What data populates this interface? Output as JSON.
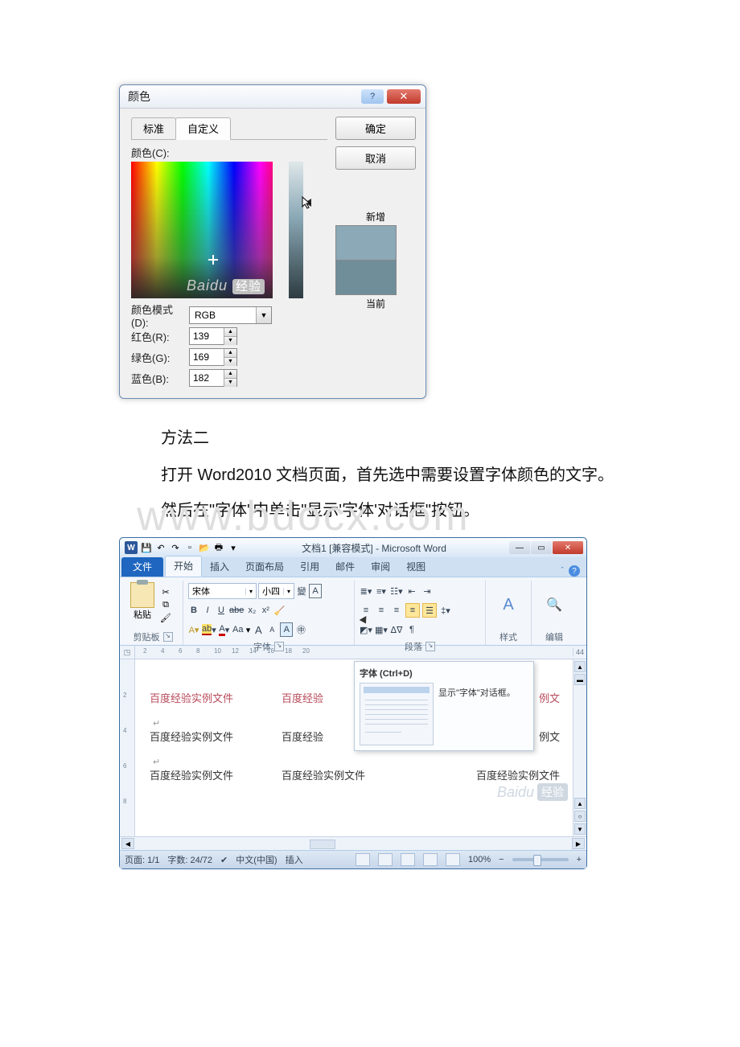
{
  "color_dialog": {
    "title": "颜色",
    "tabs": {
      "standard": "标准",
      "custom": "自定义"
    },
    "buttons": {
      "ok": "确定",
      "cancel": "取消"
    },
    "labels": {
      "colors": "颜色(C):",
      "mode": "颜色模式(D):",
      "red": "红色(R):",
      "green": "绿色(G):",
      "blue": "蓝色(B):",
      "new": "新增",
      "current": "当前"
    },
    "mode_value": "RGB",
    "rgb": {
      "r": "139",
      "g": "169",
      "b": "182"
    },
    "help_glyph": "?",
    "close_glyph": "✕",
    "watermark": {
      "brand": "Baidu",
      "tag": "经验"
    }
  },
  "article": {
    "method_title": "方法二",
    "p1": "打开 Word2010 文档页面，首先选中需要设置字体颜色的文字。",
    "p2": "然后在\"字体\"中单击\"显示'字体'对话框\"按钮。",
    "big_watermark": "www.bdocx.com"
  },
  "word": {
    "title": "文档1 [兼容模式] - Microsoft Word",
    "qat": {
      "save": "💾",
      "undo": "↶",
      "redo": "↷",
      "new": "▫",
      "open": "📂",
      "print": "🖶",
      "more": "▾"
    },
    "window_buttons": {
      "min": "—",
      "max": "▭",
      "close": "✕"
    },
    "tabs": {
      "file": "文件",
      "home": "开始",
      "insert": "插入",
      "layout": "页面布局",
      "references": "引用",
      "mailings": "邮件",
      "review": "审阅",
      "view": "视图"
    },
    "ribbon_right": {
      "minimize": "ˆ",
      "help": "?"
    },
    "groups": {
      "clipboard": {
        "title": "剪贴板",
        "paste": "粘贴"
      },
      "font": {
        "title": "字体",
        "name": "宋体",
        "size": "小四",
        "grow": "A",
        "shrink": "A",
        "case": "Aa",
        "bold": "B",
        "italic": "I",
        "underline": "U",
        "strike": "abe",
        "sub": "x₂",
        "sup": "x²",
        "effects": "A",
        "highlight": "ab",
        "fontcolor": "A",
        "phonetic": "拼",
        "charborder": "A",
        "circled": "㊩",
        "clearfmt": "⌫"
      },
      "paragraph": {
        "title": "段落"
      },
      "styles": {
        "title": "样式",
        "letter": "A"
      },
      "editing": {
        "title": "编辑",
        "icon": "🔍"
      }
    },
    "tooltip": {
      "title": "字体 (Ctrl+D)",
      "desc": "显示\"字体\"对话框。"
    },
    "ruler_numbers": [
      "2",
      "4",
      "6",
      "8",
      "10",
      "12",
      "14",
      "16",
      "18",
      "20",
      "44"
    ],
    "vruler_numbers": [
      "2",
      "4",
      "6",
      "8"
    ],
    "doc_text": {
      "line": "百度经验实例文件",
      "line_short": "百度经验",
      "line_tail": "例文"
    },
    "statusbar": {
      "page": "页面: 1/1",
      "words": "字数: 24/72",
      "lang": "中文(中国)",
      "insert": "插入",
      "zoom": "100%",
      "minus": "−",
      "plus": "+"
    },
    "watermark": {
      "brand": "Baidu",
      "tag": "经验"
    }
  }
}
